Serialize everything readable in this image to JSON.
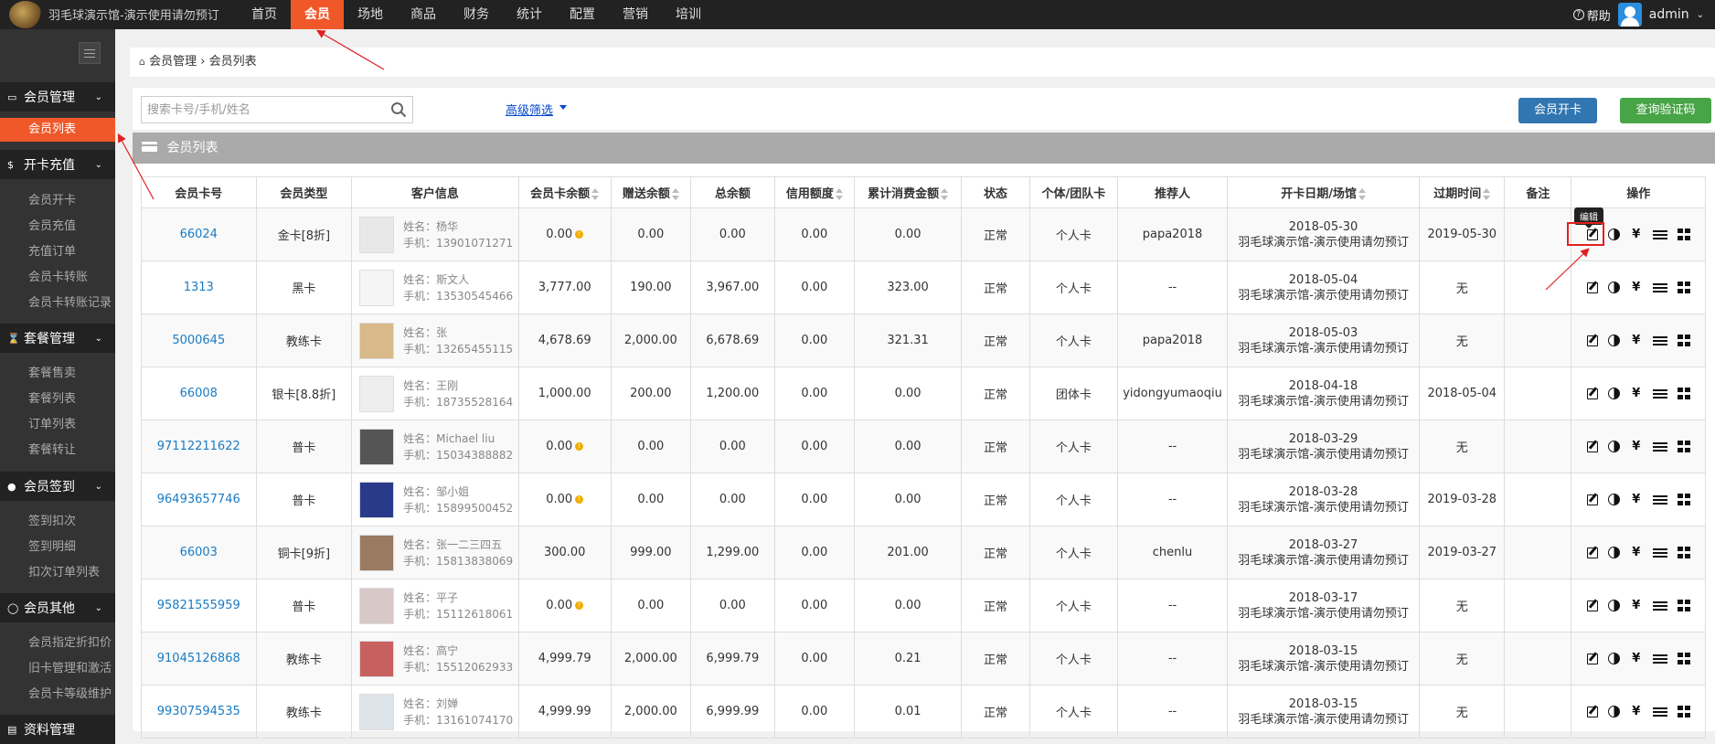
{
  "app": {
    "title": "羽毛球演示馆-演示使用请勿预订"
  },
  "nav": [
    "首页",
    "会员",
    "场地",
    "商品",
    "财务",
    "统计",
    "配置",
    "营销",
    "培训"
  ],
  "top_right": {
    "help": "帮助",
    "user": "admin"
  },
  "sidebar": {
    "groups": [
      {
        "label": "会员管理",
        "icon": "id-card-icon",
        "items": [
          "会员列表"
        ]
      },
      {
        "label": "开卡充值",
        "icon": "yen-icon",
        "items": [
          "会员开卡",
          "会员充值",
          "充值订单",
          "会员卡转账",
          "会员卡转账记录"
        ]
      },
      {
        "label": "套餐管理",
        "icon": "hourglass-icon",
        "items": [
          "套餐售卖",
          "套餐列表",
          "订单列表",
          "套餐转让"
        ]
      },
      {
        "label": "会员签到",
        "icon": "map-pin-icon",
        "items": [
          "签到扣次",
          "签到明细",
          "扣次订单列表"
        ]
      },
      {
        "label": "会员其他",
        "icon": "circle-icon",
        "items": [
          "会员指定折扣价",
          "旧卡管理和激活",
          "会员卡等级维护"
        ]
      },
      {
        "label": "资料管理",
        "icon": "folder-icon",
        "items": []
      }
    ]
  },
  "breadcrumb": [
    "会员管理",
    "会员列表"
  ],
  "toolbar": {
    "search_placeholder": "搜索卡号/手机/姓名",
    "advanced": "高级筛选",
    "open_card": "会员开卡",
    "verify_code": "查询验证码"
  },
  "list_title": "会员列表",
  "columns": [
    "会员卡号",
    "会员类型",
    "客户信息",
    "会员卡余额",
    "赠送余额",
    "总余额",
    "信用额度",
    "累计消费金额",
    "状态",
    "个体/团队卡",
    "推荐人",
    "开卡日期/场馆",
    "过期时间",
    "备注",
    "操作"
  ],
  "tooltip": "编辑",
  "rows": [
    {
      "card": "66024",
      "type": "金卡[8折]",
      "name": "姓名：杨华",
      "phone": "手机：13901071271",
      "balance": "0.00",
      "warn": true,
      "gift": "0.00",
      "total": "0.00",
      "credit": "0.00",
      "spent": "0.00",
      "status": "正常",
      "kind": "个人卡",
      "ref": "papa2018",
      "date": "2018-05-30",
      "venue": "羽毛球演示馆-演示使用请勿预订",
      "expire": "2019-05-30",
      "note": ""
    },
    {
      "card": "1313",
      "type": "黑卡",
      "name": "姓名：斯文人",
      "phone": "手机：13530545466",
      "balance": "3,777.00",
      "warn": false,
      "gift": "190.00",
      "total": "3,967.00",
      "credit": "0.00",
      "spent": "323.00",
      "status": "正常",
      "kind": "个人卡",
      "ref": "--",
      "date": "2018-05-04",
      "venue": "羽毛球演示馆-演示使用请勿预订",
      "expire": "无",
      "note": ""
    },
    {
      "card": "5000645",
      "type": "教练卡",
      "name": "姓名：张",
      "phone": "手机：13265455115",
      "balance": "4,678.69",
      "warn": false,
      "gift": "2,000.00",
      "total": "6,678.69",
      "credit": "0.00",
      "spent": "321.31",
      "status": "正常",
      "kind": "个人卡",
      "ref": "papa2018",
      "date": "2018-05-03",
      "venue": "羽毛球演示馆-演示使用请勿预订",
      "expire": "无",
      "note": ""
    },
    {
      "card": "66008",
      "type": "银卡[8.8折]",
      "name": "姓名：王刚",
      "phone": "手机：18735528164",
      "balance": "1,000.00",
      "warn": false,
      "gift": "200.00",
      "total": "1,200.00",
      "credit": "0.00",
      "spent": "0.00",
      "status": "正常",
      "kind": "团体卡",
      "ref": "yidongyumaoqiu",
      "date": "2018-04-18",
      "venue": "羽毛球演示馆-演示使用请勿预订",
      "expire": "2018-05-04",
      "note": ""
    },
    {
      "card": "97112211622",
      "type": "普卡",
      "name": "姓名：Michael liu",
      "phone": "手机：15034388882",
      "balance": "0.00",
      "warn": true,
      "gift": "0.00",
      "total": "0.00",
      "credit": "0.00",
      "spent": "0.00",
      "status": "正常",
      "kind": "个人卡",
      "ref": "--",
      "date": "2018-03-29",
      "venue": "羽毛球演示馆-演示使用请勿预订",
      "expire": "无",
      "note": ""
    },
    {
      "card": "96493657746",
      "type": "普卡",
      "name": "姓名：邹小姐",
      "phone": "手机：15899500452",
      "balance": "0.00",
      "warn": true,
      "gift": "0.00",
      "total": "0.00",
      "credit": "0.00",
      "spent": "0.00",
      "status": "正常",
      "kind": "个人卡",
      "ref": "--",
      "date": "2018-03-28",
      "venue": "羽毛球演示馆-演示使用请勿预订",
      "expire": "2019-03-28",
      "note": ""
    },
    {
      "card": "66003",
      "type": "铜卡[9折]",
      "name": "姓名：张一二三四五",
      "phone": "手机：15813838069",
      "balance": "300.00",
      "warn": false,
      "gift": "999.00",
      "total": "1,299.00",
      "credit": "0.00",
      "spent": "201.00",
      "status": "正常",
      "kind": "个人卡",
      "ref": "chenlu",
      "date": "2018-03-27",
      "venue": "羽毛球演示馆-演示使用请勿预订",
      "expire": "2019-03-27",
      "note": ""
    },
    {
      "card": "95821555959",
      "type": "普卡",
      "name": "姓名：平子",
      "phone": "手机：15112618061",
      "balance": "0.00",
      "warn": true,
      "gift": "0.00",
      "total": "0.00",
      "credit": "0.00",
      "spent": "0.00",
      "status": "正常",
      "kind": "个人卡",
      "ref": "--",
      "date": "2018-03-17",
      "venue": "羽毛球演示馆-演示使用请勿预订",
      "expire": "无",
      "note": ""
    },
    {
      "card": "91045126868",
      "type": "教练卡",
      "name": "姓名：高宁",
      "phone": "手机：15512062933",
      "balance": "4,999.79",
      "warn": false,
      "gift": "2,000.00",
      "total": "6,999.79",
      "credit": "0.00",
      "spent": "0.21",
      "status": "正常",
      "kind": "个人卡",
      "ref": "--",
      "date": "2018-03-15",
      "venue": "羽毛球演示馆-演示使用请勿预订",
      "expire": "无",
      "note": ""
    },
    {
      "card": "99307594535",
      "type": "教练卡",
      "name": "姓名：刘婵",
      "phone": "手机：13161074170",
      "balance": "4,999.99",
      "warn": false,
      "gift": "2,000.00",
      "total": "6,999.99",
      "credit": "0.00",
      "spent": "0.01",
      "status": "正常",
      "kind": "个人卡",
      "ref": "--",
      "date": "2018-03-15",
      "venue": "羽毛球演示馆-演示使用请勿预订",
      "expire": "无",
      "note": ""
    }
  ],
  "colors": {
    "accent": "#f0582a",
    "sidebar_bg": "#333333",
    "topbar_bg": "#222222",
    "link": "#1a7bc4",
    "btn_blue": "#3276b1",
    "btn_green": "#47a447",
    "annotation": "#e02020"
  }
}
